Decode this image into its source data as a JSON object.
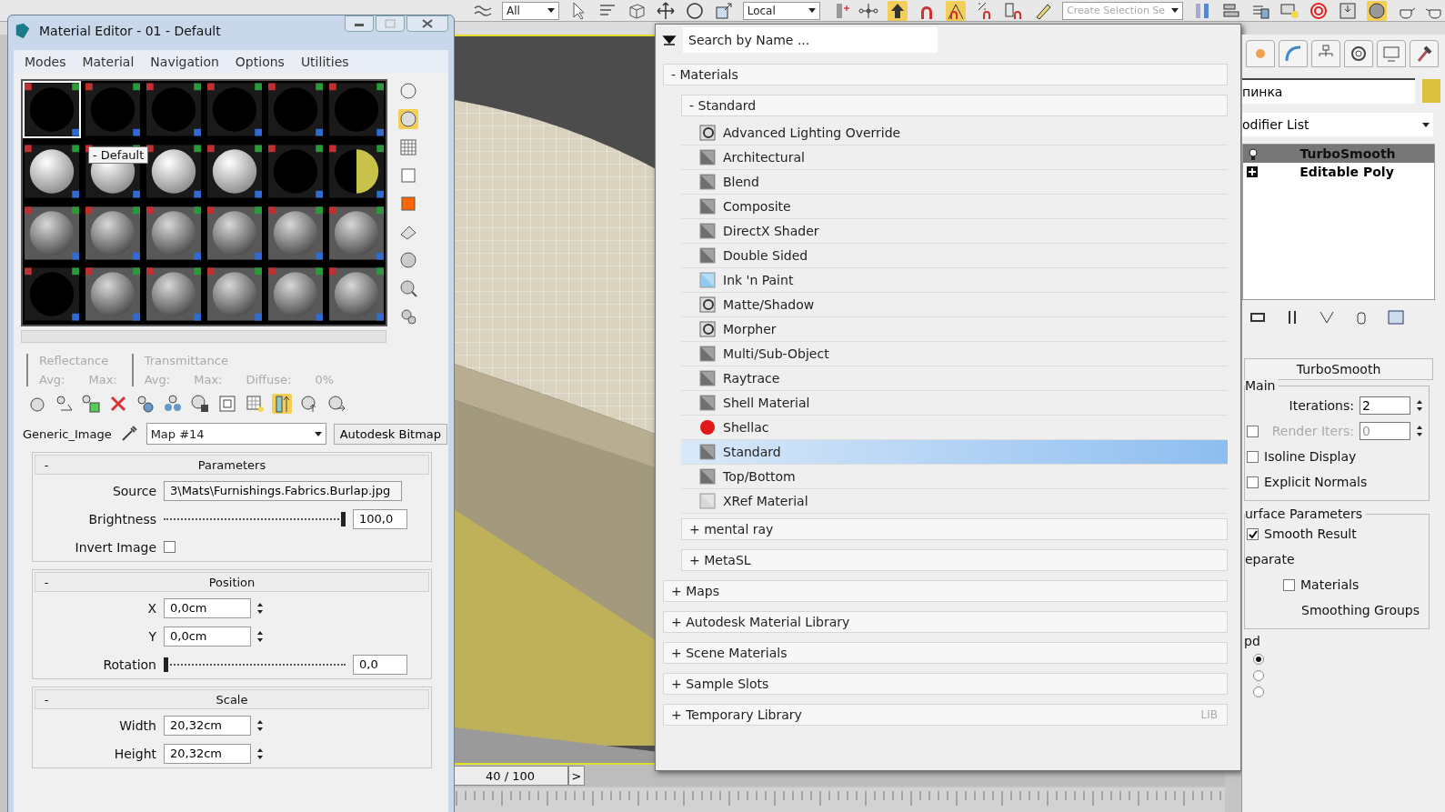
{
  "toolbar": {
    "selection_filter": "All",
    "coordinate_system": "Local",
    "selection_set_placeholder": "Create Selection Se",
    "angle_snap_on": true
  },
  "viewport": {
    "kind": "picture",
    "active": true
  },
  "time_slider": {
    "frame": "40 / 100",
    "next": ">"
  },
  "material_editor": {
    "title": "Material Editor - 01 - Default",
    "menus": [
      "Modes",
      "Material",
      "Navigation",
      "Options",
      "Utilities"
    ],
    "slots": [
      {
        "kind": "dark",
        "selected": true
      },
      {
        "kind": "dark",
        "selected": false
      },
      {
        "kind": "dark",
        "selected": false
      },
      {
        "kind": "dark",
        "selected": false
      },
      {
        "kind": "dark",
        "selected": false
      },
      {
        "kind": "dark",
        "selected": false
      },
      {
        "kind": "light",
        "selected": false
      },
      {
        "kind": "light",
        "selected": false
      },
      {
        "kind": "light",
        "selected": false
      },
      {
        "kind": "light",
        "selected": false
      },
      {
        "kind": "dark",
        "selected": false
      },
      {
        "kind": "half",
        "selected": false
      },
      {
        "kind": "grey",
        "selected": false
      },
      {
        "kind": "grey",
        "selected": false
      },
      {
        "kind": "grey",
        "selected": false
      },
      {
        "kind": "grey",
        "selected": false
      },
      {
        "kind": "grey",
        "selected": false
      },
      {
        "kind": "grey",
        "selected": false
      },
      {
        "kind": "dark",
        "selected": false
      },
      {
        "kind": "grey",
        "selected": false
      },
      {
        "kind": "grey",
        "selected": false
      },
      {
        "kind": "grey",
        "selected": false
      },
      {
        "kind": "grey",
        "selected": false
      },
      {
        "kind": "grey",
        "selected": false
      }
    ],
    "slot_tooltip": "- Default",
    "reflectance": {
      "label": "Reflectance",
      "avg": "Avg:",
      "max": "Max:"
    },
    "transmittance": {
      "label": "Transmittance",
      "avg": "Avg:",
      "max": "Max:",
      "diffuse": "Diffuse:",
      "diffuse_value": "0%"
    },
    "show_map_in_viewport_on": true,
    "map_type_label": "Generic_Image",
    "map_name": "Map #14",
    "map_type_button": "Autodesk Bitmap",
    "rollouts": [
      {
        "toggle": "-",
        "title": "Parameters",
        "rows": [
          {
            "kind": "text",
            "label": "Source",
            "value": "3\\Mats\\Furnishings.Fabrics.Burlap.jpg"
          },
          {
            "kind": "slider",
            "label": "Brightness",
            "level": 1,
            "value": "100,0"
          },
          {
            "kind": "checkbox",
            "label": "Invert Image",
            "checked": false
          }
        ]
      },
      {
        "toggle": "-",
        "title": "Position",
        "rows": [
          {
            "kind": "spinner",
            "label": "X",
            "value": "0,0cm"
          },
          {
            "kind": "spinner",
            "label": "Y",
            "value": "0,0cm"
          },
          {
            "kind": "slider",
            "label": "Rotation",
            "level": 0,
            "value": "0,0"
          }
        ]
      },
      {
        "toggle": "-",
        "title": "Scale",
        "rows": [
          {
            "kind": "spinner",
            "label": "Width",
            "value": "20,32cm"
          },
          {
            "kind": "spinner",
            "label": "Height",
            "value": "20,32cm"
          }
        ]
      }
    ]
  },
  "browser": {
    "search_placeholder": "Search by Name ...",
    "groups": [
      {
        "toggle": "-",
        "label": "Materials",
        "children": [
          {
            "toggle": "-",
            "label": "Standard",
            "items": [
              {
                "label": "Advanced Lighting Override",
                "kind": "special",
                "selected": false
              },
              {
                "label": "Architectural",
                "kind": "grey",
                "selected": false
              },
              {
                "label": "Blend",
                "kind": "grey",
                "selected": false
              },
              {
                "label": "Composite",
                "kind": "grey",
                "selected": false
              },
              {
                "label": "DirectX Shader",
                "kind": "grey",
                "selected": false
              },
              {
                "label": "Double Sided",
                "kind": "grey",
                "selected": false
              },
              {
                "label": "Ink 'n Paint",
                "kind": "blue",
                "selected": false
              },
              {
                "label": "Matte/Shadow",
                "kind": "special",
                "selected": false
              },
              {
                "label": "Morpher",
                "kind": "special",
                "selected": false
              },
              {
                "label": "Multi/Sub-Object",
                "kind": "grey",
                "selected": false
              },
              {
                "label": "Raytrace",
                "kind": "grey",
                "selected": false
              },
              {
                "label": "Shell Material",
                "kind": "grey",
                "selected": false
              },
              {
                "label": "Shellac",
                "kind": "red",
                "selected": false
              },
              {
                "label": "Standard",
                "kind": "grey",
                "selected": true
              },
              {
                "label": "Top/Bottom",
                "kind": "grey",
                "selected": false
              },
              {
                "label": "XRef Material",
                "kind": "light",
                "selected": false
              }
            ]
          },
          {
            "toggle": "+",
            "label": "mental ray"
          },
          {
            "toggle": "+",
            "label": "MetaSL"
          }
        ]
      },
      {
        "toggle": "+",
        "label": "Maps"
      },
      {
        "toggle": "+",
        "label": "Autodesk Material Library"
      },
      {
        "toggle": "+",
        "label": "Scene Materials"
      },
      {
        "toggle": "+",
        "label": "Sample Slots"
      },
      {
        "toggle": "+",
        "label": "Temporary Library",
        "badge": "LIB"
      }
    ]
  },
  "command_panel": {
    "object_name": "пинка",
    "modifier_list": "odifier List",
    "stack": [
      {
        "label": "TurboSmooth",
        "kind": "modifier",
        "selected": true
      },
      {
        "label": "Editable Poly",
        "kind": "base",
        "selected": false
      }
    ],
    "rollout": {
      "title": "TurboSmooth",
      "main": {
        "title": "Main",
        "iterations": {
          "label": "Iterations:",
          "value": "2"
        },
        "render_iters": {
          "label": "Render Iters:",
          "value": "0",
          "checked": false,
          "disabled": true
        },
        "options": [
          {
            "label": "Isoline Display",
            "checked": false
          },
          {
            "label": "Explicit Normals",
            "checked": false
          }
        ]
      },
      "surface": {
        "title": "urface Parameters",
        "smooth_result": {
          "label": "Smooth Result",
          "checked": true
        },
        "separate": "eparate",
        "options": [
          {
            "kind": "checkbox",
            "label": "Materials",
            "checked": false
          },
          {
            "kind": "label",
            "label": "Smoothing Groups"
          }
        ]
      },
      "update": {
        "title": "pd",
        "radios": [
          {
            "selected": true
          },
          {
            "selected": false
          },
          {
            "selected": false
          }
        ]
      }
    }
  }
}
